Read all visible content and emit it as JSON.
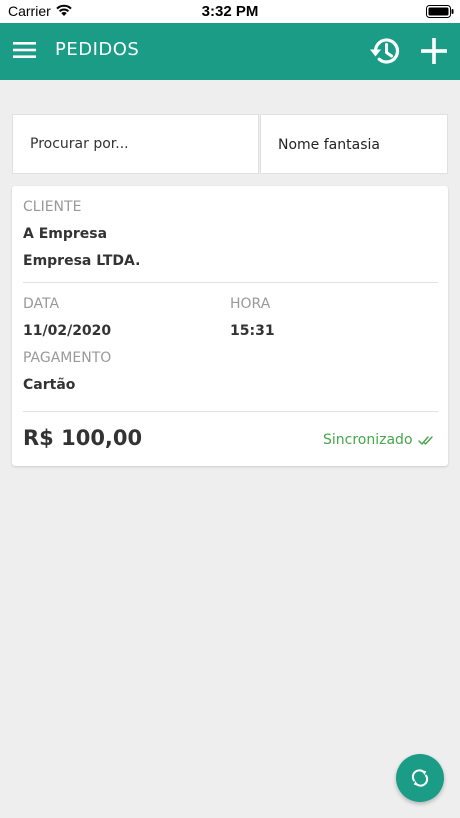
{
  "status_bar": {
    "carrier": "Carrier",
    "time": "3:32 PM"
  },
  "header": {
    "title": "PEDIDOS"
  },
  "search": {
    "placeholder": "Procurar por...",
    "filter_value": "Nome fantasia"
  },
  "order": {
    "client_label": "CLIENTE",
    "client_name": "A Empresa",
    "client_company": "Empresa LTDA.",
    "date_label": "DATA",
    "date_value": "11/02/2020",
    "time_label": "HORA",
    "time_value": "15:31",
    "payment_label": "PAGAMENTO",
    "payment_value": "Cartão",
    "total": "R$ 100,00",
    "sync_status": "Sincronizado"
  },
  "colors": {
    "primary": "#1a9c87",
    "synced": "#45a64c",
    "background": "#eeeeee"
  },
  "icons": [
    "wifi-icon",
    "battery-icon",
    "menu-icon",
    "history-icon",
    "add-icon",
    "double-check-icon",
    "sync-icon"
  ]
}
